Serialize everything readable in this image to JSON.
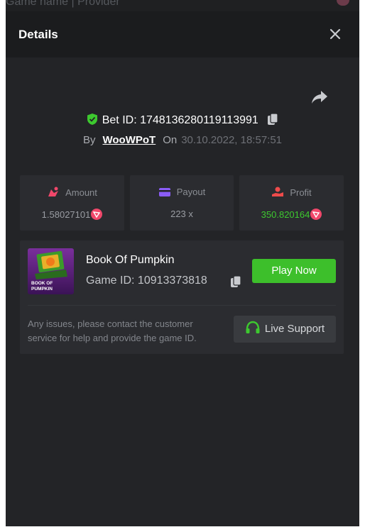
{
  "background": {
    "title": "Game name | Provider"
  },
  "modal": {
    "title": "Details",
    "close_icon": "close-icon",
    "share_icon": "share-icon"
  },
  "bet": {
    "id_label": "Bet ID:",
    "id_value": "1748136280119113991",
    "by_label": "By",
    "user": "WooWPoT",
    "on_label": "On",
    "datetime": "30.10.2022, 18:57:51"
  },
  "stats": {
    "amount": {
      "label": "Amount",
      "value": "1.58027101",
      "icon": "amount-icon"
    },
    "payout": {
      "label": "Payout",
      "value": "223 x",
      "icon": "card-icon"
    },
    "profit": {
      "label": "Profit",
      "value": "350.820164",
      "icon": "profit-icon"
    }
  },
  "game": {
    "name": "Book Of Pumpkin",
    "id_label": "Game ID:",
    "id_value": "10913373818",
    "thumb_text": "BOOK OF PUMPKIN",
    "play_label": "Play Now",
    "issues_text": "Any issues, please contact the customer service for help and provide the game ID.",
    "support_label": "Live Support"
  },
  "colors": {
    "accent_green": "#3dbf2b",
    "profit_green": "#3dc92f",
    "coin_pink": "#f0476a",
    "payout_purple": "#8a5cf6",
    "profit_red": "#ef4b4b"
  }
}
